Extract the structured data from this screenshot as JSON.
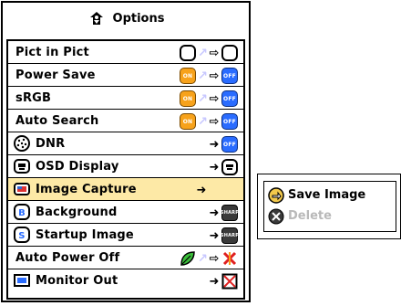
{
  "menu": {
    "title": "Options",
    "title_icon": "options-icon",
    "items": [
      {
        "label": "Pict in Pict",
        "icon": null,
        "state": "pip"
      },
      {
        "label": "Power Save",
        "icon": null,
        "state": "on-off",
        "on_text": "ON",
        "off_text": "OFF"
      },
      {
        "label": "sRGB",
        "icon": null,
        "state": "on-off",
        "on_text": "ON",
        "off_text": "OFF"
      },
      {
        "label": "Auto Search",
        "icon": null,
        "state": "on-off",
        "on_text": "ON",
        "off_text": "OFF"
      },
      {
        "label": "DNR",
        "icon": "dnr-icon",
        "state": "off",
        "off_text": "OFF"
      },
      {
        "label": "OSD Display",
        "icon": "osd-display-icon",
        "state": "disp"
      },
      {
        "label": "Image Capture",
        "icon": "image-capture-icon",
        "state": "arrow",
        "selected": true
      },
      {
        "label": "Background",
        "icon": "background-icon",
        "state": "sharp",
        "sharp_text": "SHARP"
      },
      {
        "label": "Startup Image",
        "icon": "startup-image-icon",
        "state": "sharp",
        "sharp_text": "SHARP"
      },
      {
        "label": "Auto Power Off",
        "icon": null,
        "state": "leaf-x"
      },
      {
        "label": "Monitor Out",
        "icon": "monitor-out-icon",
        "state": "xbox"
      }
    ]
  },
  "submenu": {
    "items": [
      {
        "label": "Save Image",
        "icon": "save-image-icon",
        "enabled": true
      },
      {
        "label": "Delete",
        "icon": "delete-icon",
        "enabled": false
      }
    ]
  },
  "colors": {
    "selected_row": "#fde9a6",
    "on": "#f7a21b",
    "off": "#2a6cff"
  }
}
